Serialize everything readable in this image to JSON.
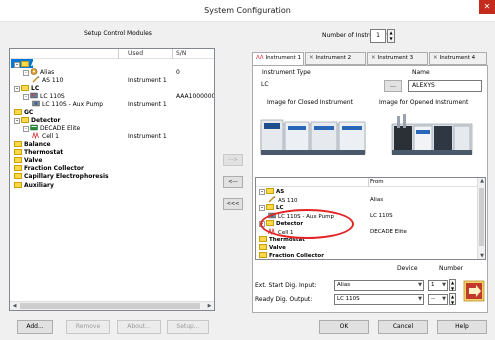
{
  "window": {
    "title": "System Configuration",
    "close_glyph": "✕"
  },
  "left": {
    "header": "Setup Control Modules",
    "columns": {
      "used": "Used",
      "sn": "S/N"
    },
    "tree": [
      {
        "label": "AS",
        "bold": true,
        "icon": "folder-icon",
        "expander": "⊟",
        "used": "",
        "sn": ""
      },
      {
        "label": "Alias",
        "bold": false,
        "icon": "autosampler-icon",
        "expander": "⊟",
        "used": "",
        "sn": "0"
      },
      {
        "label": "AS 110",
        "bold": false,
        "icon": "needle-icon",
        "expander": "",
        "used": "Instrument 1",
        "sn": ""
      },
      {
        "label": "LC",
        "bold": true,
        "icon": "folder-icon",
        "expander": "⊟",
        "used": "",
        "sn": ""
      },
      {
        "label": "LC 110S",
        "bold": false,
        "icon": "lc-module-icon",
        "expander": "⊟",
        "used": "",
        "sn": "AAA1000000"
      },
      {
        "label": "LC 110S - Aux Pump",
        "bold": false,
        "icon": "pump-icon",
        "expander": "",
        "used": "Instrument 1",
        "sn": ""
      },
      {
        "label": "GC",
        "bold": true,
        "icon": "folder-icon",
        "expander": "",
        "used": "",
        "sn": ""
      },
      {
        "label": "Detector",
        "bold": true,
        "icon": "folder-icon",
        "expander": "⊟",
        "used": "",
        "sn": ""
      },
      {
        "label": "DECADE Elite",
        "bold": false,
        "icon": "detector-icon",
        "expander": "⊟",
        "used": "",
        "sn": ""
      },
      {
        "label": "Cell 1",
        "bold": false,
        "icon": "cell-icon",
        "expander": "",
        "used": "Instrument 1",
        "sn": ""
      },
      {
        "label": "Balance",
        "bold": true,
        "icon": "folder-icon",
        "expander": "",
        "used": "",
        "sn": ""
      },
      {
        "label": "Thermostat",
        "bold": true,
        "icon": "folder-icon",
        "expander": "",
        "used": "",
        "sn": ""
      },
      {
        "label": "Valve",
        "bold": true,
        "icon": "folder-icon",
        "expander": "",
        "used": "",
        "sn": ""
      },
      {
        "label": "Fraction Collector",
        "bold": true,
        "icon": "folder-icon",
        "expander": "",
        "used": "",
        "sn": ""
      },
      {
        "label": "Capillary Electrophoresis",
        "bold": true,
        "icon": "folder-icon",
        "expander": "",
        "used": "",
        "sn": ""
      },
      {
        "label": "Auxiliary",
        "bold": true,
        "icon": "folder-icon",
        "expander": "",
        "used": "",
        "sn": ""
      }
    ],
    "buttons": {
      "add": "Add...",
      "remove": "Remove",
      "about": "About...",
      "setup": "Setup..."
    }
  },
  "transfer": {
    "add": "--->",
    "remove": "<---",
    "remove_all": "<<<"
  },
  "right": {
    "num_instruments_label": "Number of Instruments:",
    "num_instruments_value": "1",
    "tabs": [
      {
        "label": "Instrument 1",
        "active": true
      },
      {
        "label": "Instrument 2",
        "active": false
      },
      {
        "label": "Instrument 3",
        "active": false
      },
      {
        "label": "Instrument 4",
        "active": false
      }
    ],
    "instrument_type_label": "Instrument Type",
    "instrument_type_value": "LC",
    "browse_label": "...",
    "name_label": "Name",
    "name_value": "ALEXYS",
    "closed_image_label": "Image for Closed Instrument",
    "opened_image_label": "Image for Opened Instrument",
    "list_from_header": "From",
    "list": [
      {
        "label": "AS",
        "bold": true,
        "from": ""
      },
      {
        "label": "AS 110",
        "bold": false,
        "from": "Alias"
      },
      {
        "label": "LC",
        "bold": true,
        "from": ""
      },
      {
        "label": "LC 110S - Aux Pump",
        "bold": false,
        "from": "LC 110S"
      },
      {
        "label": "Detector",
        "bold": true,
        "from": ""
      },
      {
        "label": "Cell 1",
        "bold": false,
        "from": "DECADE Elite"
      },
      {
        "label": "Thermostat",
        "bold": true,
        "from": ""
      },
      {
        "label": "Valve",
        "bold": true,
        "from": ""
      },
      {
        "label": "Fraction Collector",
        "bold": true,
        "from": ""
      }
    ],
    "device_header": "Device",
    "number_header": "Number",
    "ext_start_label": "Ext. Start Dig. Input:",
    "ext_start_device": "Alias",
    "ext_start_number": "1",
    "ready_label": "Ready Dig. Output:",
    "ready_device": "LC 110S",
    "ready_number": "--"
  },
  "footer": {
    "ok": "OK",
    "cancel": "Cancel",
    "help": "Help"
  },
  "colors": {
    "accent": "#0078d7",
    "highlight_ring": "#e32424",
    "close": "#c42b1c"
  }
}
